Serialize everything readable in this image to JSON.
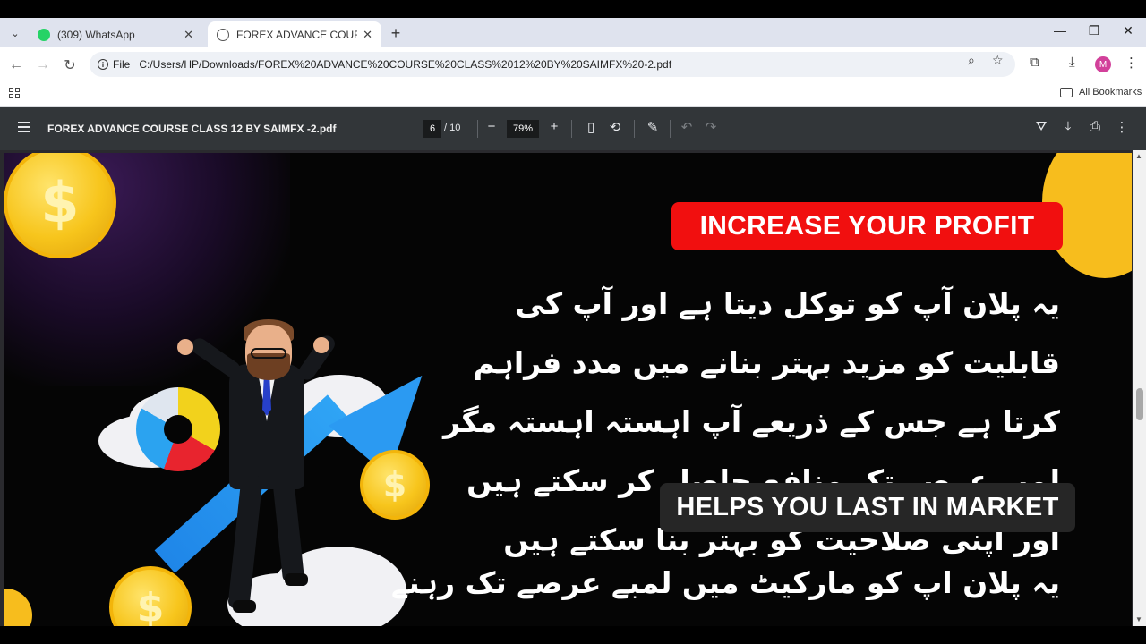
{
  "browser": {
    "tabs": [
      {
        "label": "(309) WhatsApp",
        "active": false,
        "favicon": "whatsapp-icon"
      },
      {
        "label": "FOREX ADVANCE COURSE CLAS",
        "active": true,
        "favicon": "globe-icon"
      }
    ],
    "new_tab": "+",
    "window_controls": {
      "minimize": "—",
      "restore": "❐",
      "close": "✕"
    },
    "url_chip": "File",
    "url": "C:/Users/HP/Downloads/FOREX%20ADVANCE%20COURSE%20CLASS%2012%20BY%20SAIMFX%20-2.pdf",
    "profile_initial": "M",
    "bookmarks_label": "All Bookmarks"
  },
  "pdf": {
    "title": "FOREX ADVANCE COURSE CLASS 12 BY SAIMFX -2.pdf",
    "current_page": "6",
    "total_pages": "/ 10",
    "zoom": "79%"
  },
  "content": {
    "heading1": "INCREASE YOUR PROFIT",
    "paragraph1": "یہ پلان آپ کو توکل دیتا ہے اور آپ کی قابلیت کو مزید بہتر بنانے میں مدد فراہم کرتا ہے جس کے ذریعے آپ اہستہ اہستہ مگر لمبے عرصے تک منافع حاصل کر سکتے ہیں اور اپنی صلاحیت کو بہتر بنا سکتے ہیں",
    "heading2": "HELPS YOU LAST IN MARKET",
    "paragraph2": "یہ پلان اپ کو مارکیٹ میں لمبے عرصے تک رہنے اور لمبے عرصے کی کامیابی",
    "coin_symbol": "$"
  },
  "colors": {
    "red_banner": "#f10f0f",
    "dark_banner": "#262626",
    "coin": "#f7c51c",
    "arrow": "#2b9af2",
    "pdf_toolbar": "#323639"
  }
}
